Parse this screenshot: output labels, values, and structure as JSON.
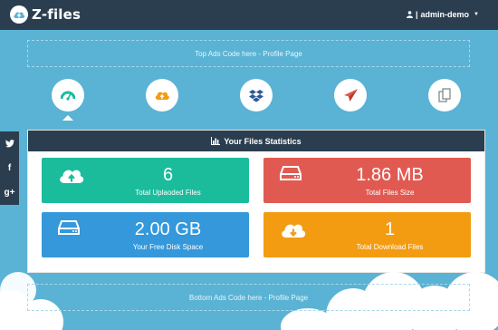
{
  "brand": {
    "name": "Z-files"
  },
  "user": {
    "name": "admin-demo"
  },
  "ads": {
    "top": "Top Ads Code here - Profile Page",
    "bottom": "Bottom Ads Code here - Profile Page"
  },
  "nav_icons": [
    {
      "icon": "dashboard-icon",
      "color": "#1abc9c"
    },
    {
      "icon": "cloud-upload-icon",
      "color": "#f39c12"
    },
    {
      "icon": "dropbox-icon",
      "color": "#2b5797"
    },
    {
      "icon": "paper-plane-icon",
      "color": "#e05a52"
    },
    {
      "icon": "files-icon",
      "color": "#7f8c8d"
    }
  ],
  "social": [
    {
      "icon": "twitter-icon",
      "glyph": "🐦"
    },
    {
      "icon": "facebook-icon",
      "glyph": "f"
    },
    {
      "icon": "google-plus-icon",
      "glyph": "g+"
    }
  ],
  "stats": {
    "title": "Your Files Statistics",
    "cards": [
      {
        "value": "6",
        "label": "Total Uplaoded Files",
        "color": "#1abc9c",
        "icon": "cloud-upload-icon"
      },
      {
        "value": "1.86 MB",
        "label": "Total Files Size",
        "color": "#e05a52",
        "icon": "hard-drive-icon"
      },
      {
        "value": "2.00 GB",
        "label": "Your Free Disk Space",
        "color": "#3498db",
        "icon": "hard-drive-icon"
      },
      {
        "value": "1",
        "label": "Total Download Files",
        "color": "#f39c12",
        "icon": "cloud-download-icon"
      }
    ]
  }
}
